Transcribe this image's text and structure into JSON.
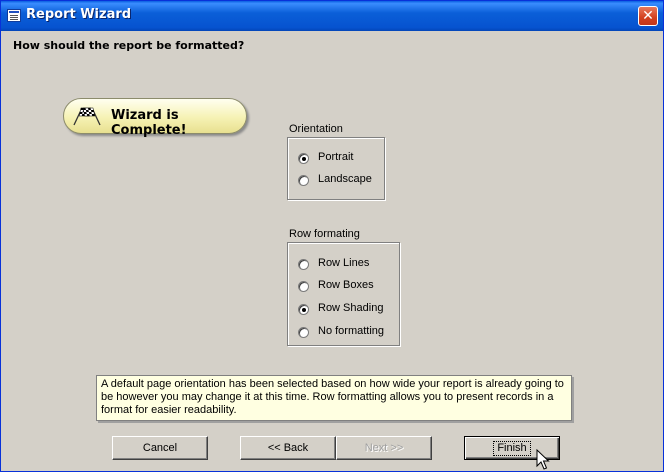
{
  "window": {
    "title": "Report Wizard",
    "close_glyph": "✕"
  },
  "heading": "How should the report be formatted?",
  "badge": {
    "text": "Wizard is Complete!",
    "icon": "checkered-flag-icon"
  },
  "orientation": {
    "label": "Orientation",
    "options": [
      {
        "label": "Portrait",
        "checked": true
      },
      {
        "label": "Landscape",
        "checked": false
      }
    ]
  },
  "row_formatting": {
    "label": "Row formating",
    "options": [
      {
        "label": "Row Lines",
        "checked": false
      },
      {
        "label": "Row Boxes",
        "checked": false
      },
      {
        "label": "Row Shading",
        "checked": true
      },
      {
        "label": "No formatting",
        "checked": false
      }
    ]
  },
  "tip_text": "A default page orientation has been selected based on how wide your report is already going to be however you may change it at this time.  Row formatting allows you to present records in a format for easier readability.",
  "buttons": {
    "cancel": "Cancel",
    "back": "<< Back",
    "next": "Next >>",
    "finish": "Finish"
  },
  "colors": {
    "titlebar": "#0653d0",
    "dialog_bg": "#d4d0c8",
    "tip_bg": "#ffffe1",
    "close": "#d2401f",
    "badge": "#f6f2b4"
  }
}
